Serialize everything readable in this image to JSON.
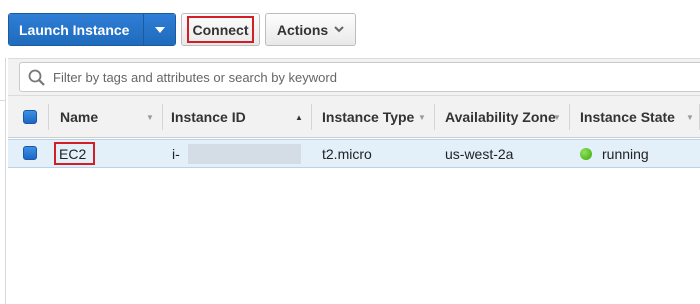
{
  "toolbar": {
    "launch_label": "Launch Instance",
    "connect_label": "Connect",
    "actions_label": "Actions"
  },
  "search": {
    "placeholder": "Filter by tags and attributes or search by keyword"
  },
  "table": {
    "columns": [
      "Name",
      "Instance ID",
      "Instance Type",
      "Availability Zone",
      "Instance State"
    ],
    "rows": [
      {
        "name": "EC2",
        "instance_id": "i-",
        "instance_type": "t2.micro",
        "availability_zone": "us-west-2a",
        "instance_state": "running"
      }
    ]
  },
  "colors": {
    "primary_button": "#1f6bbd",
    "highlight_outline": "#d21f26",
    "selected_row": "#e3eff9",
    "status_running": "#3aa70e"
  }
}
